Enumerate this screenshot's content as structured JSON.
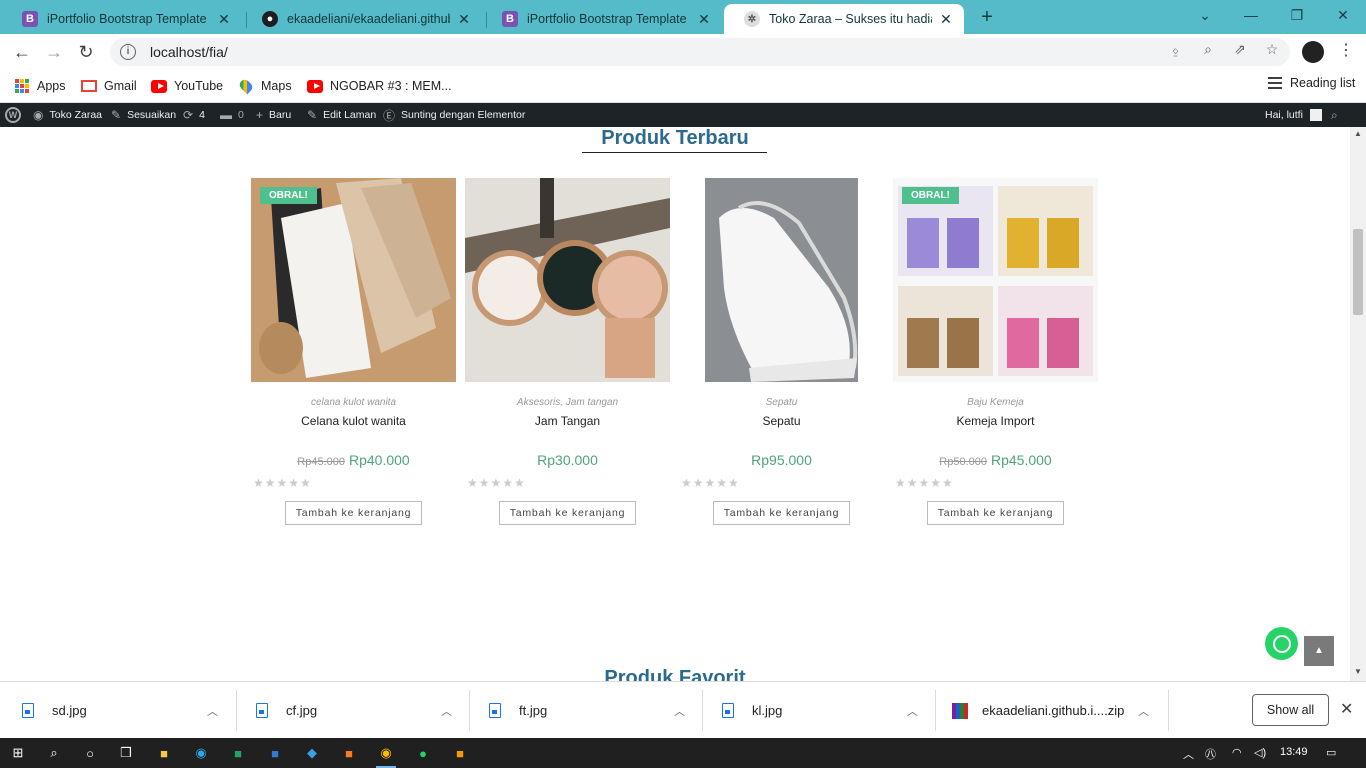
{
  "browser": {
    "tabs": [
      {
        "title": "iPortfolio Bootstrap Template - In",
        "icon": "bootstrap-icon",
        "active": false
      },
      {
        "title": "ekaadeliani/ekaadeliani.github.io",
        "icon": "github-icon",
        "active": false
      },
      {
        "title": "iPortfolio Bootstrap Template - In",
        "icon": "bootstrap-icon",
        "active": false
      },
      {
        "title": "Toko Zaraa – Sukses itu hadiah b",
        "icon": "wordpress-icon",
        "active": true
      }
    ],
    "new_tab_label": "+",
    "url": "localhost/fia/",
    "bookmarks": [
      {
        "label": "Apps",
        "icon": "apps-grid-icon"
      },
      {
        "label": "Gmail",
        "icon": "gmail-icon"
      },
      {
        "label": "YouTube",
        "icon": "youtube-icon"
      },
      {
        "label": "Maps",
        "icon": "maps-icon"
      },
      {
        "label": "NGOBAR #3 : MEM...",
        "icon": "youtube-icon"
      }
    ],
    "reading_list": "Reading list"
  },
  "wp_admin_bar": {
    "site_name": "Toko Zaraa",
    "customize": "Sesuaikan",
    "updates_count": "4",
    "comments_count": "0",
    "new_label": "Baru",
    "edit_page": "Edit Laman",
    "elementor": "Sunting dengan Elementor",
    "greeting": "Hai, lutfi"
  },
  "page": {
    "section_title": "Produk Terbaru",
    "next_section_title": "Produk Favorit",
    "sale_badge": "OBRAL!",
    "add_to_cart": "Tambah ke keranjang",
    "products": [
      {
        "category": "celana kulot wanita",
        "name": "Celana kulot wanita",
        "old_price": "Rp45.000",
        "price": "Rp40.000",
        "on_sale": true,
        "rating": 0
      },
      {
        "category": "Aksesoris, Jam tangan",
        "name": "Jam Tangan",
        "old_price": "",
        "price": "Rp30.000",
        "on_sale": false,
        "rating": 0
      },
      {
        "category": "Sepatu",
        "name": "Sepatu",
        "old_price": "",
        "price": "Rp95.000",
        "on_sale": false,
        "rating": 0
      },
      {
        "category": "Baju Kemeja",
        "name": "Kemeja Import",
        "old_price": "Rp50.000",
        "price": "Rp45.000",
        "on_sale": true,
        "rating": 0
      }
    ]
  },
  "downloads": {
    "files": [
      "sd.jpg",
      "cf.jpg",
      "ft.jpg",
      "kl.jpg",
      "ekaadeliani.github.i....zip"
    ],
    "show_all": "Show all"
  },
  "taskbar": {
    "clock": "13:49"
  },
  "colors": {
    "tab_strip": "#56bbc8",
    "accent_green": "#4fa37c",
    "title_blue": "#2c6a8e",
    "wp_bar": "#1d2327"
  }
}
